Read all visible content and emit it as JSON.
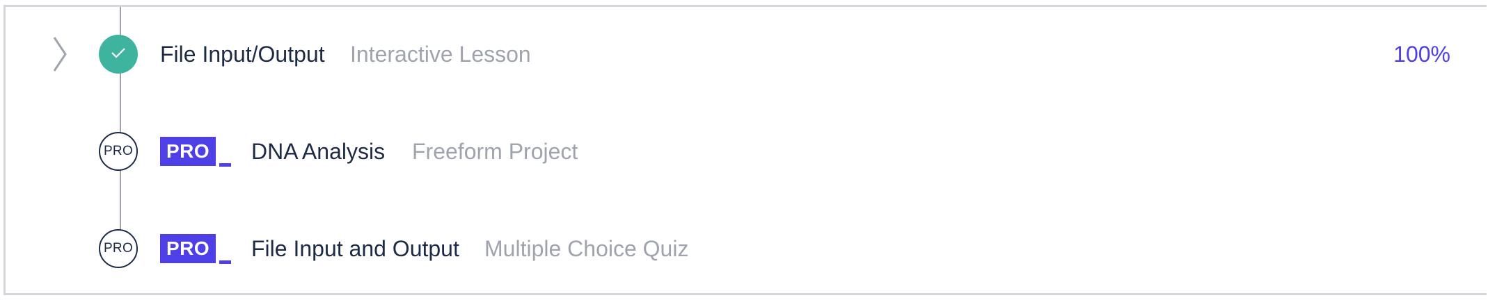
{
  "lessons": [
    {
      "title": "File Input/Output",
      "type": "Interactive Lesson",
      "progress": "100%",
      "status": "complete",
      "icon": "check-icon"
    },
    {
      "node_label": "PRO",
      "badge": "PRO",
      "title": "DNA Analysis",
      "type": "Freeform Project",
      "status": "locked"
    },
    {
      "node_label": "PRO",
      "badge": "PRO",
      "title": "File Input and Output",
      "type": "Multiple Choice Quiz",
      "status": "locked"
    }
  ],
  "colors": {
    "complete": "#3eb49f",
    "pro": "#4e3fe6",
    "text": "#1c2a45",
    "muted": "#9ea3ad",
    "border": "#d4d6dc"
  }
}
